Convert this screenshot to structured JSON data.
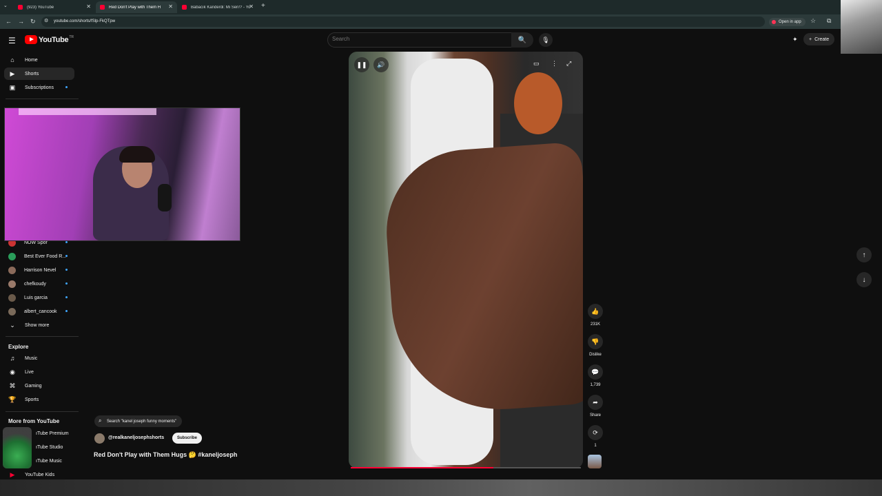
{
  "browser": {
    "tabs": [
      {
        "title": "(923) YouTube",
        "active": false
      },
      {
        "title": "Red Don't Play with Them H",
        "active": true
      },
      {
        "title": "Babacık Kanderdi: Mi Sen!? - Yo",
        "active": false
      }
    ],
    "new_tab": "+",
    "url": "youtube.com/shorts/fSlp-FkQTpw",
    "open_in_app": "Open in app"
  },
  "masthead": {
    "logo_text": "YouTube",
    "country_code": "TR",
    "search_placeholder": "Search",
    "create_label": "Create"
  },
  "sidebar": {
    "main": [
      {
        "label": "Home",
        "icon": "home-icon"
      },
      {
        "label": "Shorts",
        "icon": "shorts-icon",
        "active": true
      },
      {
        "label": "Subscriptions",
        "icon": "subscriptions-icon",
        "new": true
      }
    ],
    "subscriptions": [
      {
        "label": "NOW Spor"
      },
      {
        "label": "Best Ever Food R..."
      },
      {
        "label": "Harrison Nevel"
      },
      {
        "label": "chefkoudy"
      },
      {
        "label": "Luis garcia"
      },
      {
        "label": "albert_cancook"
      }
    ],
    "show_more": "Show more",
    "explore_heading": "Explore",
    "explore": [
      {
        "label": "Music",
        "icon": "music-icon"
      },
      {
        "label": "Live",
        "icon": "live-icon"
      },
      {
        "label": "Gaming",
        "icon": "gaming-icon"
      },
      {
        "label": "Sports",
        "icon": "sports-icon"
      }
    ],
    "more_heading": "More from YouTube",
    "more": [
      {
        "label": "YouTube Premium",
        "visible": "ıTube Premium"
      },
      {
        "label": "YouTube Studio",
        "visible": "ıTube Studio"
      },
      {
        "label": "YouTube Music",
        "visible": "ıTube Music"
      },
      {
        "label": "YouTube Kids",
        "visible": "YouTube Kids"
      }
    ]
  },
  "short": {
    "progress": 0.62,
    "actions": {
      "like_count": "231K",
      "dislike_label": "Dislike",
      "comment_count": "1,739",
      "share_label": "Share",
      "remix_count": "1"
    },
    "suggested_search": "Search \"kanel joseph funny moments\"",
    "channel": "@realkaneljosephshorts",
    "subscribe_label": "Subscribe",
    "title": "Red Don't Play with Them Hugs 🤔 #kaneljoseph"
  },
  "colors": {
    "accent": "#ff0033",
    "background": "#0f0f0f",
    "new_dot": "#3ea6ff"
  }
}
